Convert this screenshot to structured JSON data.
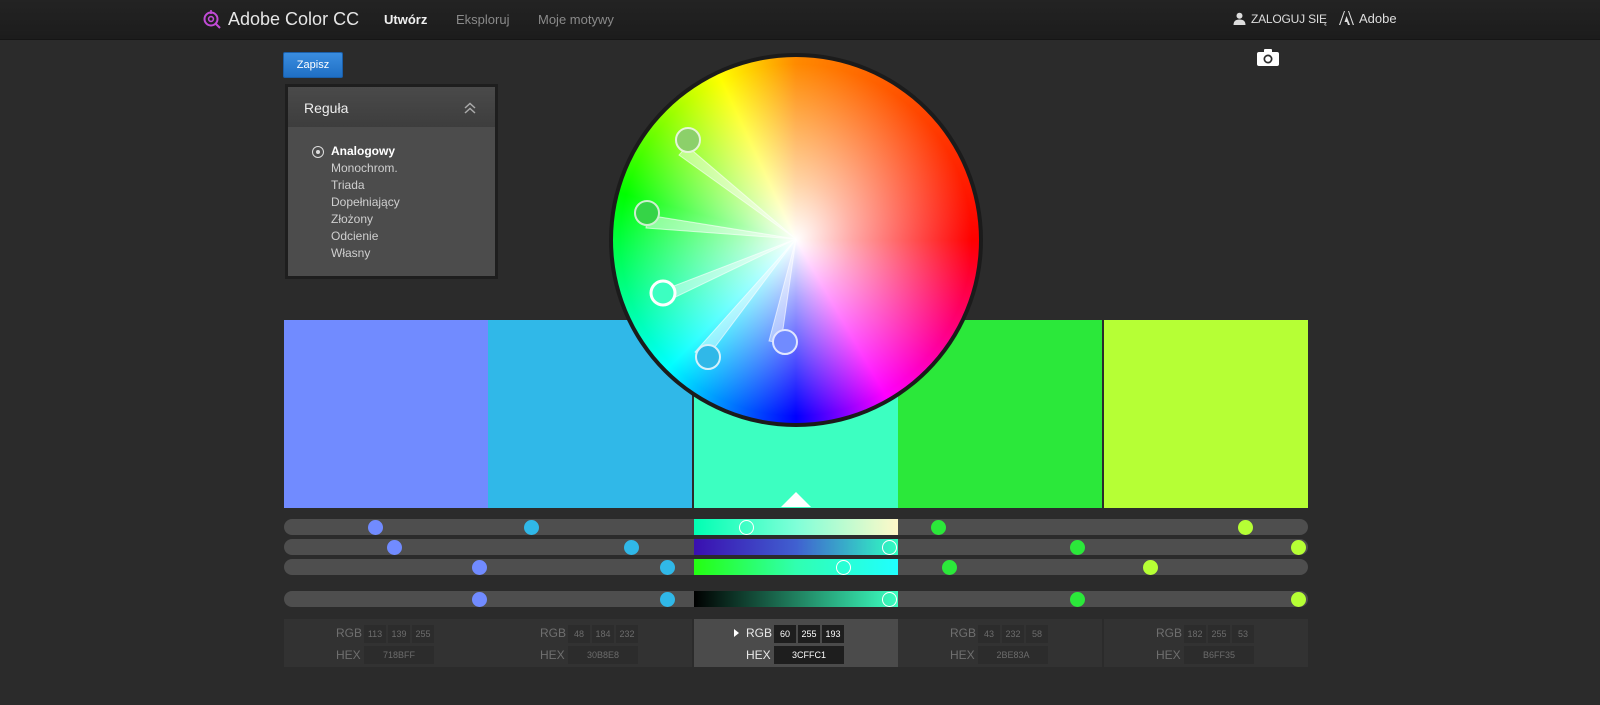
{
  "header": {
    "brand": "Adobe Color CC",
    "nav": [
      "Utwórz",
      "Eksploruj",
      "Moje motywy"
    ],
    "login": "ZALOGUJ SIĘ",
    "adobe": "Adobe"
  },
  "toolbar": {
    "save_label": "Zapisz"
  },
  "rule": {
    "title": "Reguła",
    "items": [
      "Analogowy",
      "Monochrom.",
      "Triada",
      "Dopełniający",
      "Złożony",
      "Odcienie",
      "Własny"
    ],
    "selected": "Analogowy"
  },
  "swatches": [
    {
      "hex": "#718BFF",
      "rgb": [
        "113",
        "139",
        "255"
      ],
      "hex_label": "718BFF"
    },
    {
      "hex": "#30B8E8",
      "rgb": [
        "48",
        "184",
        "232"
      ],
      "hex_label": "30B8E8"
    },
    {
      "hex": "#3CFFC1",
      "rgb": [
        "60",
        "255",
        "193"
      ],
      "hex_label": "3CFFC1"
    },
    {
      "hex": "#2BE83A",
      "rgb": [
        "43",
        "232",
        "58"
      ],
      "hex_label": "2BE83A"
    },
    {
      "hex": "#B6FF35",
      "rgb": [
        "182",
        "255",
        "53"
      ],
      "hex_label": "B6FF35"
    }
  ],
  "active_swatch": 2,
  "value_labels": {
    "rgb": "RGB",
    "hex": "HEX"
  }
}
